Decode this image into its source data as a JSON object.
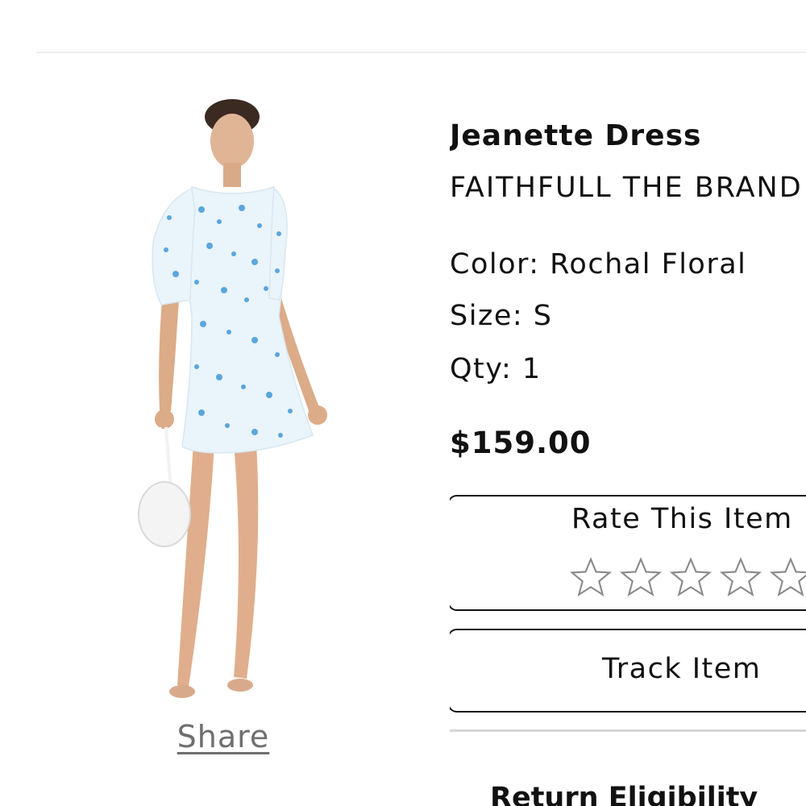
{
  "product": {
    "name": "Jeanette Dress",
    "brand": "FAITHFULL THE BRAND",
    "color": "Color: Rochal Floral",
    "size": "Size: S",
    "qty": "Qty: 1",
    "price": "$159.00"
  },
  "image": {
    "share_label": "Share"
  },
  "rating": {
    "title": "Rate This Item",
    "max_stars": 5,
    "current": 0
  },
  "actions": {
    "track_label": "Track Item"
  },
  "return_section": {
    "title": "Return Eligibility"
  },
  "colors": {
    "text": "#111111",
    "muted": "#6f6f6f",
    "divider": "#d6d6d6",
    "dress": "#eaf4fb",
    "print": "#5aa6dc"
  }
}
